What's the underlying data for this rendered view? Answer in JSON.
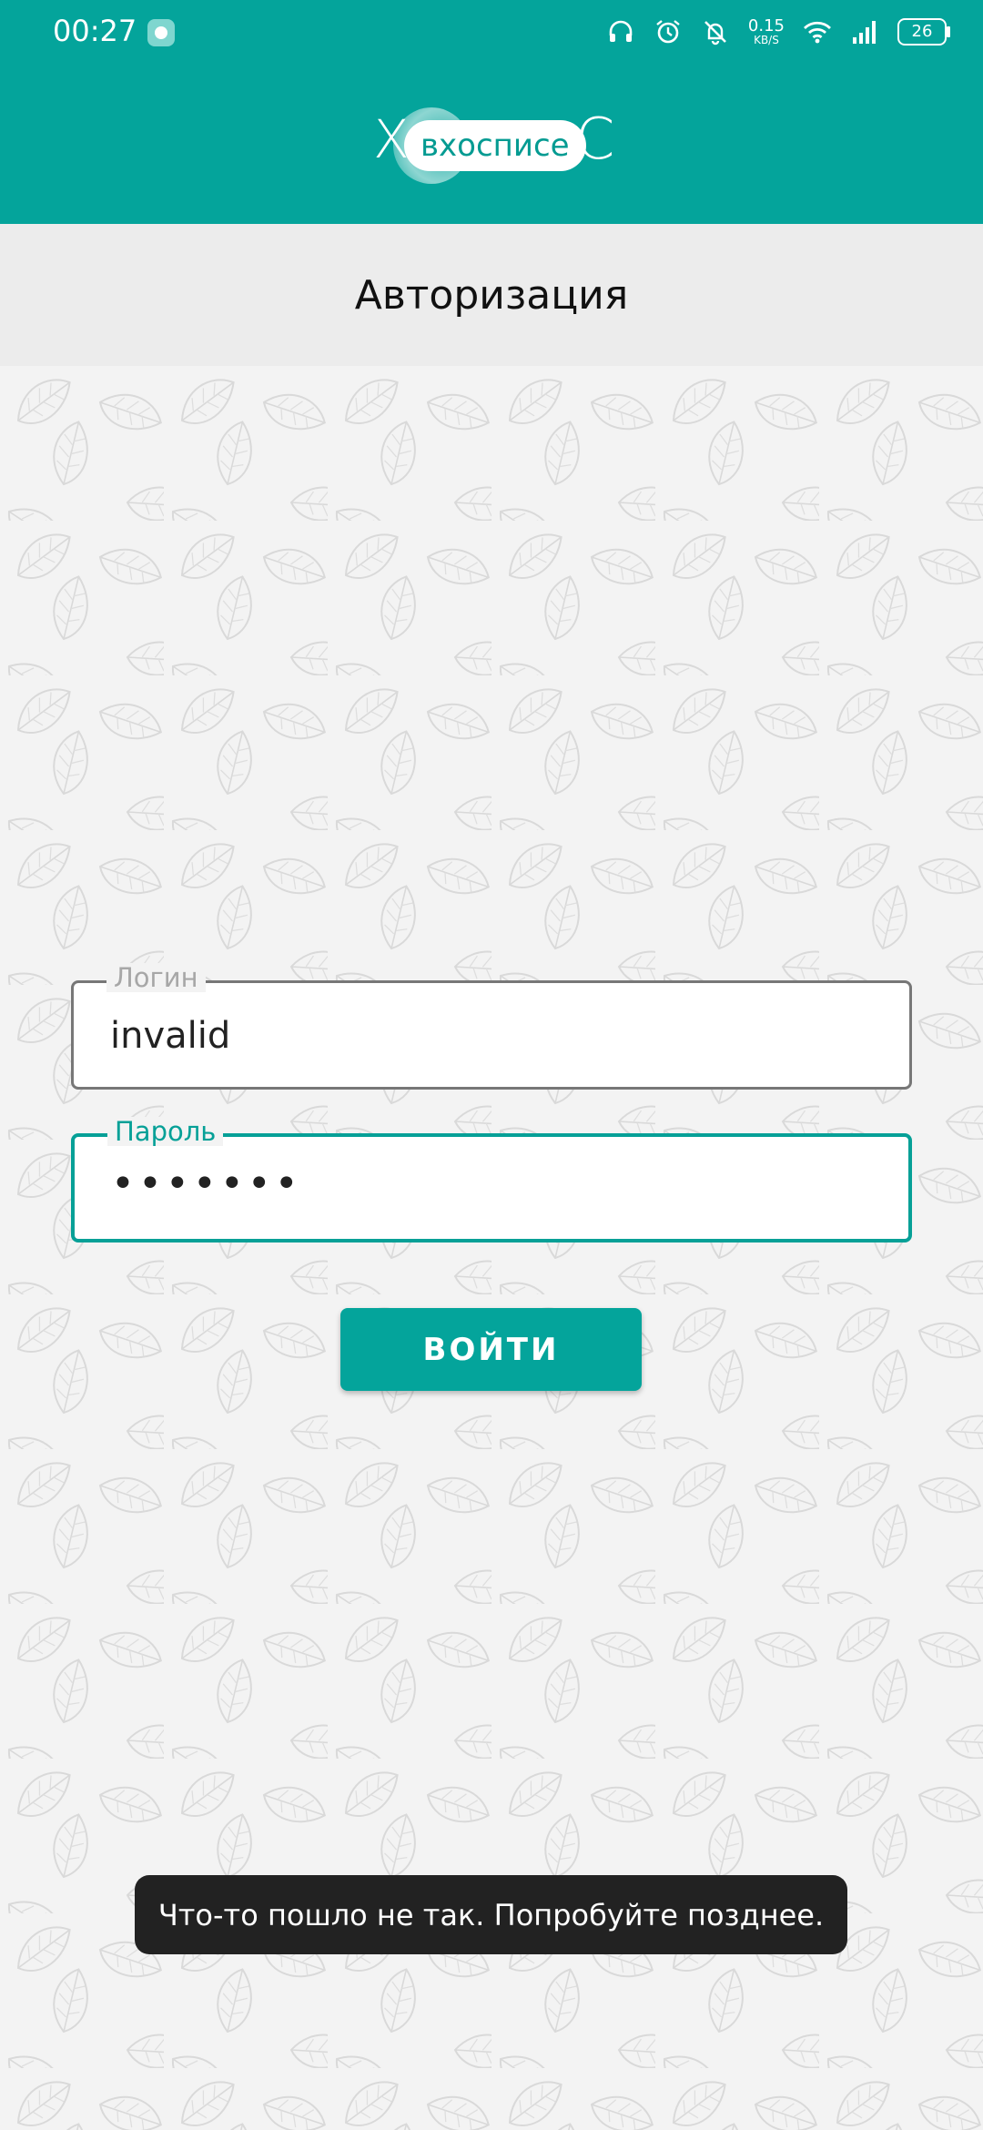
{
  "status_bar": {
    "time": "00:27",
    "net_speed_value": "0.15",
    "net_speed_unit": "KB/S",
    "battery": "26",
    "icons": [
      "message-icon",
      "headphones-icon",
      "alarm-icon",
      "muted-bell-icon",
      "wifi-icon",
      "signal-icon",
      "battery-icon"
    ]
  },
  "header": {
    "logo_text": "вхосписе",
    "logo_left": "Х",
    "logo_right": "С",
    "brand_color": "#04a49b"
  },
  "subheader": {
    "title": "Авторизация"
  },
  "form": {
    "login_label": "Логин",
    "login_value": "invalid",
    "password_label": "Пароль",
    "password_value": "•••••••",
    "submit_label": "ВОЙТИ"
  },
  "toast": {
    "message": "Что-то пошло не так. Попробуйте позднее."
  }
}
